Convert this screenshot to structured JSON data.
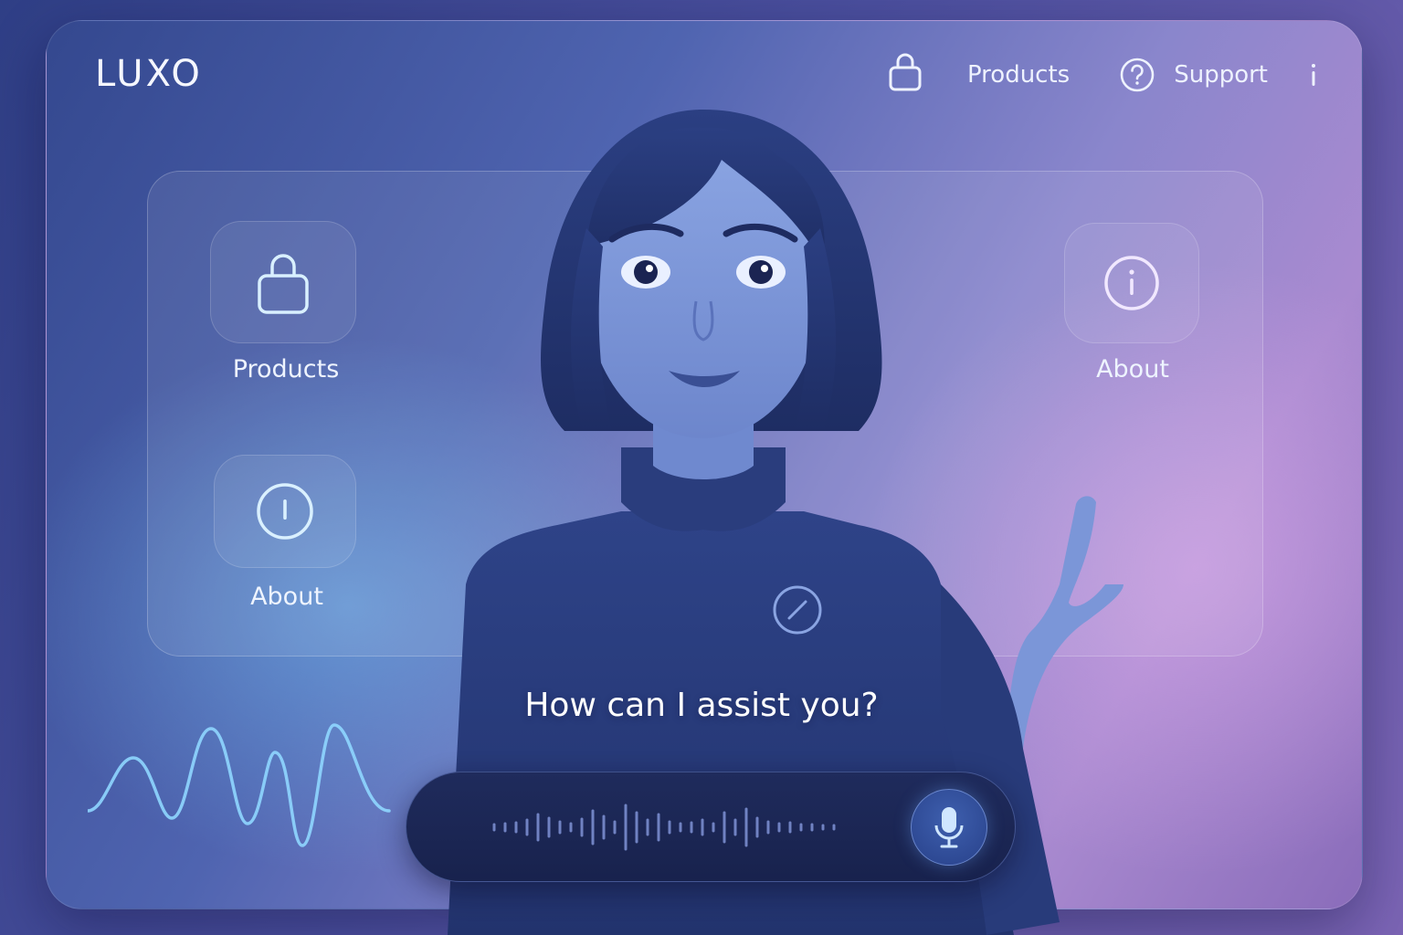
{
  "app": {
    "brand": "LUXO"
  },
  "nav": {
    "products_label": "Products",
    "support_label": "Support",
    "icons": [
      "shopping-bag-icon",
      "question-circle-icon",
      "info-icon"
    ]
  },
  "tiles": {
    "products_label": "Products",
    "about_label_left": "About",
    "about_label_right": "About"
  },
  "assistant": {
    "prompt": "How can I assist you?"
  },
  "colors": {
    "accent_glow": "#8fd6ff",
    "voice_bar_bg": "#1c2654",
    "mic_button": "#3a5aa8"
  }
}
